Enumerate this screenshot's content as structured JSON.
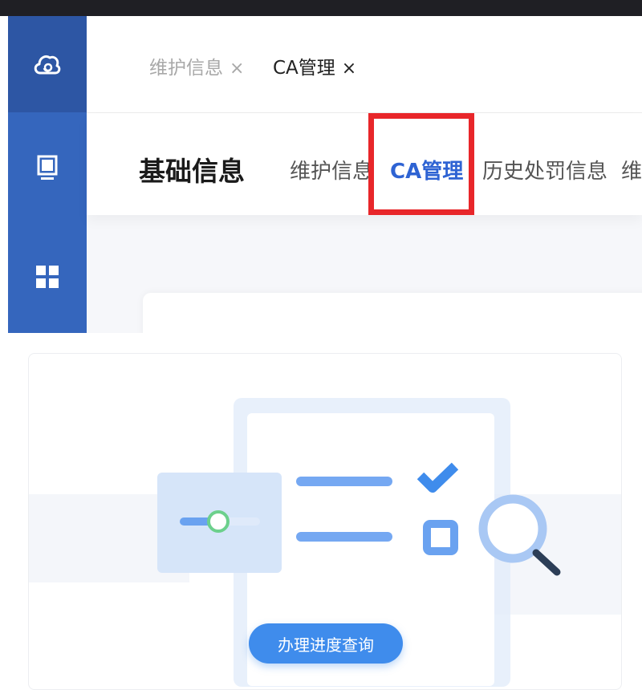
{
  "tabs": [
    {
      "label": "维护信息",
      "close_icon": "×"
    },
    {
      "label": "CA管理",
      "close_icon": "×"
    }
  ],
  "nav": {
    "title": "基础信息",
    "items": [
      {
        "label": "维护信息"
      },
      {
        "label": "CA管理"
      },
      {
        "label": "历史处罚信息"
      },
      {
        "label": "维护"
      }
    ]
  },
  "sidebar": {
    "icons": [
      "cloud-logo-icon",
      "monitor-icon",
      "apps-grid-icon"
    ]
  },
  "colors": {
    "sidebar": "#3566bd",
    "accent": "#2e63d3",
    "highlight": "#e8262a",
    "button": "#3f8cec"
  },
  "action": {
    "label": "办理进度查询"
  }
}
